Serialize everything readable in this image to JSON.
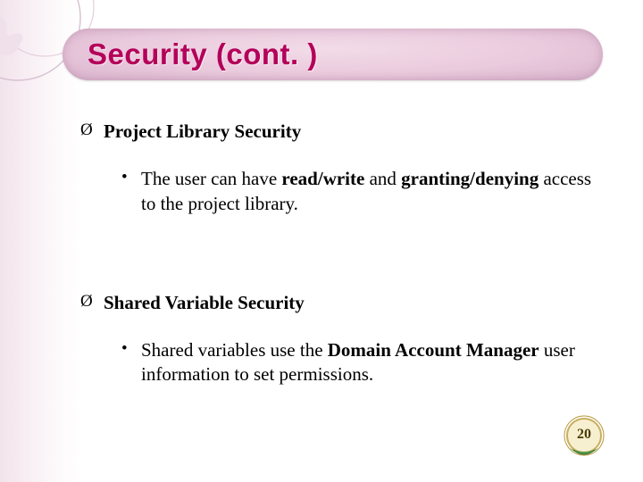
{
  "title": "Security (cont. )",
  "section1": {
    "heading": "Project Library Security",
    "body_pre": "The user can have ",
    "body_b1": "read/write",
    "body_mid": " and ",
    "body_b2": "granting/denying",
    "body_post": " access to the project library."
  },
  "section2": {
    "heading": "Shared Variable Security",
    "body_pre": "Shared variables use the ",
    "body_b1": "Domain Account Manager",
    "body_post": " user information to set permissions."
  },
  "bullet_arrow": "Ø",
  "bullet_dot": "•",
  "page_number": "20"
}
